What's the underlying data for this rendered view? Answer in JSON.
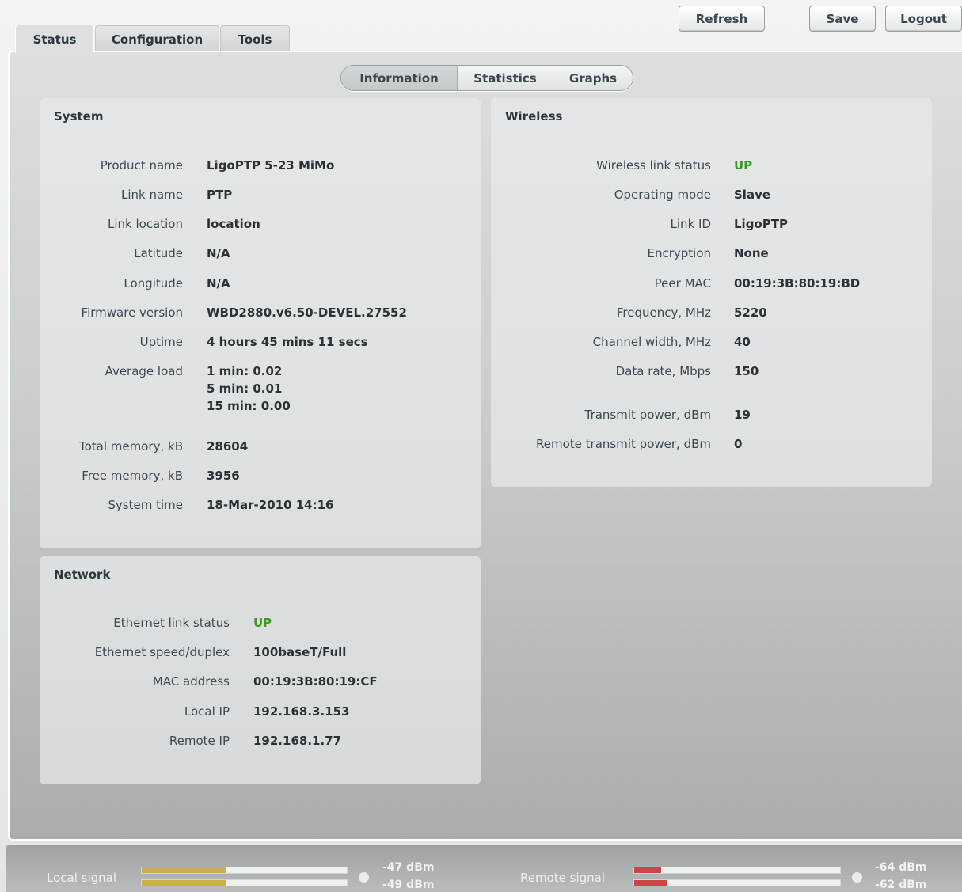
{
  "tabs": [
    {
      "label": "Status"
    },
    {
      "label": "Configuration"
    },
    {
      "label": "Tools"
    }
  ],
  "buttons": {
    "refresh": "Refresh",
    "save": "Save",
    "logout": "Logout"
  },
  "subtabs": [
    {
      "label": "Information"
    },
    {
      "label": "Statistics"
    },
    {
      "label": "Graphs"
    }
  ],
  "system": {
    "title": "System",
    "product_name": {
      "label": "Product name",
      "value": "LigoPTP 5-23 MiMo"
    },
    "link_name": {
      "label": "Link name",
      "value": "PTP"
    },
    "link_location": {
      "label": "Link location",
      "value": "location"
    },
    "latitude": {
      "label": "Latitude",
      "value": "N/A"
    },
    "longitude": {
      "label": "Longitude",
      "value": "N/A"
    },
    "firmware": {
      "label": "Firmware version",
      "value": "WBD2880.v6.50-DEVEL.27552"
    },
    "uptime": {
      "label": "Uptime",
      "value": "4 hours 45 mins 11 secs"
    },
    "average_load": {
      "label": "Average load",
      "values": [
        "1 min:  0.02",
        "5 min:  0.01",
        "15 min: 0.00"
      ]
    },
    "total_memory": {
      "label": "Total memory, kB",
      "value": "28604"
    },
    "free_memory": {
      "label": "Free memory, kB",
      "value": "3956"
    },
    "system_time": {
      "label": "System time",
      "value": "18-Mar-2010 14:16"
    }
  },
  "network": {
    "title": "Network",
    "eth_status": {
      "label": "Ethernet link status",
      "value": "UP"
    },
    "eth_speed": {
      "label": "Ethernet speed/duplex",
      "value": "100baseT/Full"
    },
    "mac": {
      "label": "MAC address",
      "value": "00:19:3B:80:19:CF"
    },
    "local_ip": {
      "label": "Local IP",
      "value": "192.168.3.153"
    },
    "remote_ip": {
      "label": "Remote IP",
      "value": "192.168.1.77"
    }
  },
  "wireless": {
    "title": "Wireless",
    "link_status": {
      "label": "Wireless link status",
      "value": "UP"
    },
    "mode": {
      "label": "Operating mode",
      "value": "Slave"
    },
    "link_id": {
      "label": "Link ID",
      "value": "LigoPTP"
    },
    "encryption": {
      "label": "Encryption",
      "value": "None"
    },
    "peer_mac": {
      "label": "Peer MAC",
      "value": "00:19:3B:80:19:BD"
    },
    "frequency": {
      "label": "Frequency, MHz",
      "value": "5220"
    },
    "channel_width": {
      "label": "Channel width, MHz",
      "value": "40"
    },
    "data_rate": {
      "label": "Data rate, Mbps",
      "value": "150"
    },
    "tx_power": {
      "label": "Transmit power, dBm",
      "value": "19"
    },
    "remote_tx_power": {
      "label": "Remote transmit power, dBm",
      "value": "0"
    }
  },
  "signal": {
    "local": {
      "label": "Local signal",
      "chain0": "-47 dBm",
      "chain1": "-49 dBm",
      "level0": 0.41,
      "level1": 0.41,
      "color": "#c9b04a"
    },
    "remote": {
      "label": "Remote signal",
      "chain0": "-64 dBm",
      "chain1": "-62 dBm",
      "level0": 0.13,
      "level1": 0.16,
      "color": "#cc4444"
    }
  },
  "colors": {
    "up": "#3a9b2a",
    "accent": "#2b3640"
  }
}
